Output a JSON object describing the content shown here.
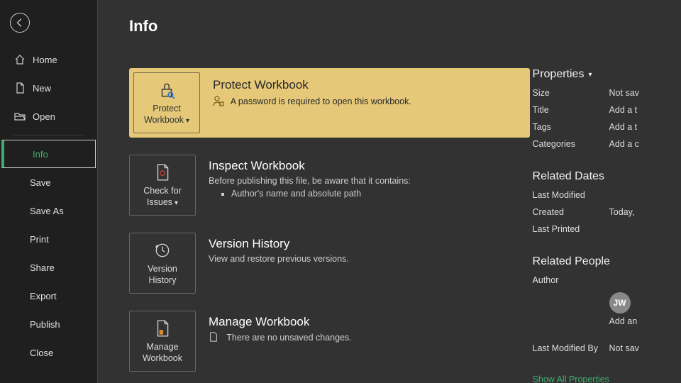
{
  "sidebar": {
    "top": [
      {
        "label": "Home"
      },
      {
        "label": "New"
      },
      {
        "label": "Open"
      }
    ],
    "mid": [
      {
        "label": "Info",
        "selected": true
      },
      {
        "label": "Save"
      },
      {
        "label": "Save As"
      },
      {
        "label": "Print"
      },
      {
        "label": "Share"
      },
      {
        "label": "Export"
      },
      {
        "label": "Publish"
      },
      {
        "label": "Close"
      }
    ]
  },
  "page": {
    "title": "Info"
  },
  "blocks": {
    "protect": {
      "tile_line1": "Protect",
      "tile_line2": "Workbook",
      "title": "Protect Workbook",
      "desc": "A password is required to open this workbook."
    },
    "inspect": {
      "tile_line1": "Check for",
      "tile_line2": "Issues",
      "title": "Inspect Workbook",
      "desc": "Before publishing this file, be aware that it contains:",
      "item": "Author's name and absolute path"
    },
    "version": {
      "tile_line1": "Version",
      "tile_line2": "History",
      "title": "Version History",
      "desc": "View and restore previous versions."
    },
    "manage": {
      "tile_line1": "Manage",
      "tile_line2": "Workbook",
      "title": "Manage Workbook",
      "desc": "There are no unsaved changes."
    }
  },
  "right": {
    "properties_head": "Properties",
    "props": {
      "size_l": "Size",
      "size_v": "Not sav",
      "title_l": "Title",
      "title_v": "Add a t",
      "tags_l": "Tags",
      "tags_v": "Add a t",
      "cat_l": "Categories",
      "cat_v": "Add a c"
    },
    "dates_head": "Related Dates",
    "dates": {
      "lm_l": "Last Modified",
      "lm_v": "",
      "cr_l": "Created",
      "cr_v": "Today,",
      "lp_l": "Last Printed",
      "lp_v": ""
    },
    "people_head": "Related People",
    "people": {
      "author_l": "Author",
      "avatar": "JW",
      "add_author": "Add an",
      "lmb_l": "Last Modified By",
      "lmb_v": "Not sav"
    },
    "show_all": "Show All Properties"
  }
}
